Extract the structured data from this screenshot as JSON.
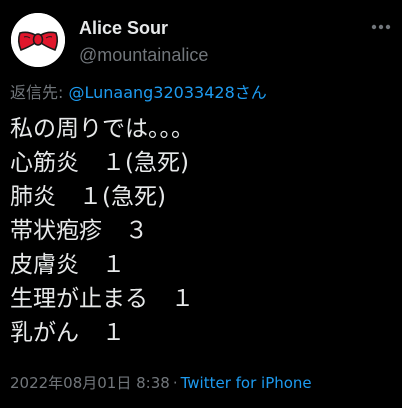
{
  "author": {
    "display_name": "Alice Sour",
    "handle": "@mountainalice",
    "avatar_icon": "hello-kitty-bow-avatar"
  },
  "more_icon": "more-horizontal-icon",
  "reply": {
    "prefix": "返信先: ",
    "mention": "@Lunaang32033428",
    "suffix": "さん"
  },
  "tweet": {
    "lines": [
      "私の周りでは。。。",
      "心筋炎　１(急死)",
      "肺炎　１(急死)",
      "帯状疱疹　３",
      "皮膚炎　１",
      "生理が止まる　１",
      "乳がん　１"
    ]
  },
  "meta": {
    "timestamp": "2022年08月01日 8:38",
    "separator": "·",
    "source": "Twitter for iPhone"
  },
  "colors": {
    "background": "#000000",
    "text": "#e7e9ea",
    "muted": "#71767b",
    "link": "#1d9bf0",
    "bow": "#e0162b"
  }
}
